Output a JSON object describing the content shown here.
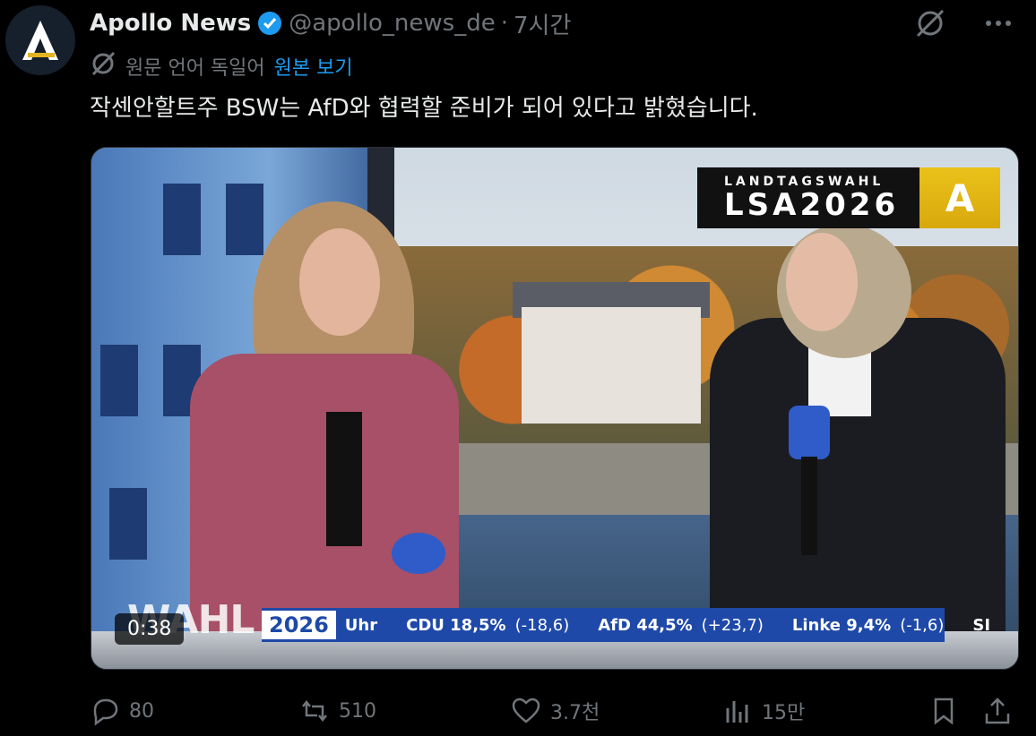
{
  "author": {
    "name": "Apollo News",
    "handle": "@apollo_news_de",
    "time": "7시간",
    "separator": "·"
  },
  "translation": {
    "label": "원문 언어 독일어",
    "link": "원본 보기"
  },
  "tweet": {
    "text": "작센안할트주 BSW는 AfD와 협력할 준비가 되어 있다고 밝혔습니다."
  },
  "video": {
    "duration": "0:38",
    "logo_small": "LANDTAGSWAHL",
    "logo_big": "LSA2026",
    "logo_letter": "A",
    "ticker_wahl": "WAHL",
    "ticker_year": "2026",
    "ticker_uhr": "Uhr",
    "ticker": [
      {
        "party": "CDU 18,5%",
        "delta": "(-18,6)"
      },
      {
        "party": "AfD 44,5%",
        "delta": "(+23,7)"
      },
      {
        "party": "Linke 9,4%",
        "delta": "(-1,6)"
      },
      {
        "party": "SI",
        "delta": ""
      }
    ]
  },
  "actions": {
    "replies": "80",
    "reposts": "510",
    "likes": "3.7천",
    "views": "15만"
  },
  "colors": {
    "accent": "#1d9bf0",
    "muted": "#71767b",
    "ticker": "#1f49a8"
  }
}
